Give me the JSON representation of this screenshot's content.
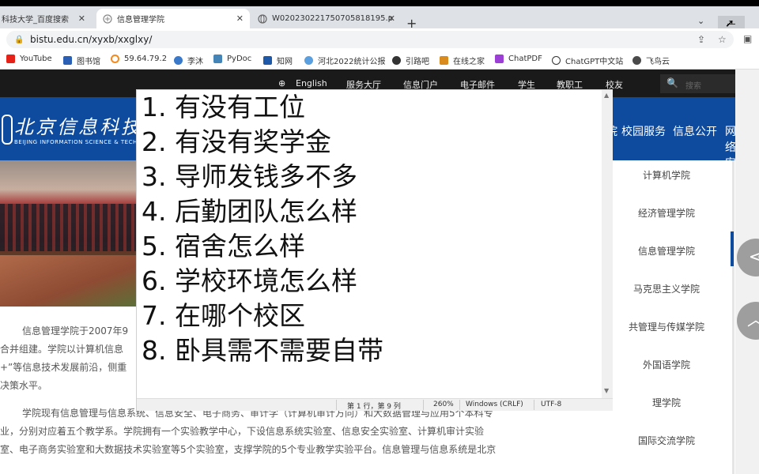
{
  "browser": {
    "tabs": [
      {
        "title": "科技大学_百度搜索",
        "active": false
      },
      {
        "title": "信息管理学院",
        "active": true
      },
      {
        "title": "W020230221750705818195.p",
        "active": false
      }
    ],
    "url": "bistu.edu.cn/xyxb/xxglxy/",
    "bookmarks": [
      "YouTube",
      "图书馆",
      "59.64.79.2",
      "李沐",
      "PyDoc",
      "知网",
      "河北2022统计公报",
      "引路吧",
      "在线之家",
      "ChatPDF",
      "ChatGPT中文站",
      "飞鸟云"
    ]
  },
  "site": {
    "top_nav": [
      "English",
      "服务大厅",
      "信息门户",
      "电子邮件",
      "学生",
      "教职工",
      "校友"
    ],
    "search_placeholder": "搜索",
    "logo_cn": "北京信息科技",
    "logo_en": "BEIJING INFORMATION SCIENCE & TECHNOLOGY",
    "banner_nav": [
      "院",
      "校园服务",
      "信息公开",
      "网络安"
    ],
    "side_menu": [
      "计算机学院",
      "经济管理学院",
      "信息管理学院",
      "马克思主义学院",
      "共管理与传媒学院",
      "外国语学院",
      "理学院",
      "国际交流学院"
    ],
    "article_lines": [
      "信息管理学院于2007年9",
      "合并组建。学院以计算机信息",
      "+”等信息技术发展前沿，侧重",
      "决策水平。",
      "学院现有信息管理与信息系统、信息安全、电子商务、审计学（计算机审计方向）和大数据管理与应用5个本科专",
      "业，分别对应着五个教学系。学院拥有一个实验教学中心，下设信息系统实验室、信息安全实验室、计算机审计实验",
      "室、电子商务实验室和大数据技术实验室等5个实验室，支撑学院的5个专业教学实验平台。信息管理与信息系统是北京"
    ]
  },
  "editor": {
    "lines": [
      "1. 有没有工位",
      "2. 有没有奖学金",
      "3. 导师发钱多不多",
      "4. 后勤团队怎么样",
      "5. 宿舍怎么样",
      "6. 学校环境怎么样",
      "7. 在哪个校区",
      "8. 卧具需不需要自带"
    ],
    "status": {
      "position": "第 1 行，第 9 列",
      "zoom": "260%",
      "line_ending": "Windows (CRLF)",
      "encoding": "UTF-8"
    }
  },
  "colors": {
    "brand_blue": "#0e4a9e"
  }
}
